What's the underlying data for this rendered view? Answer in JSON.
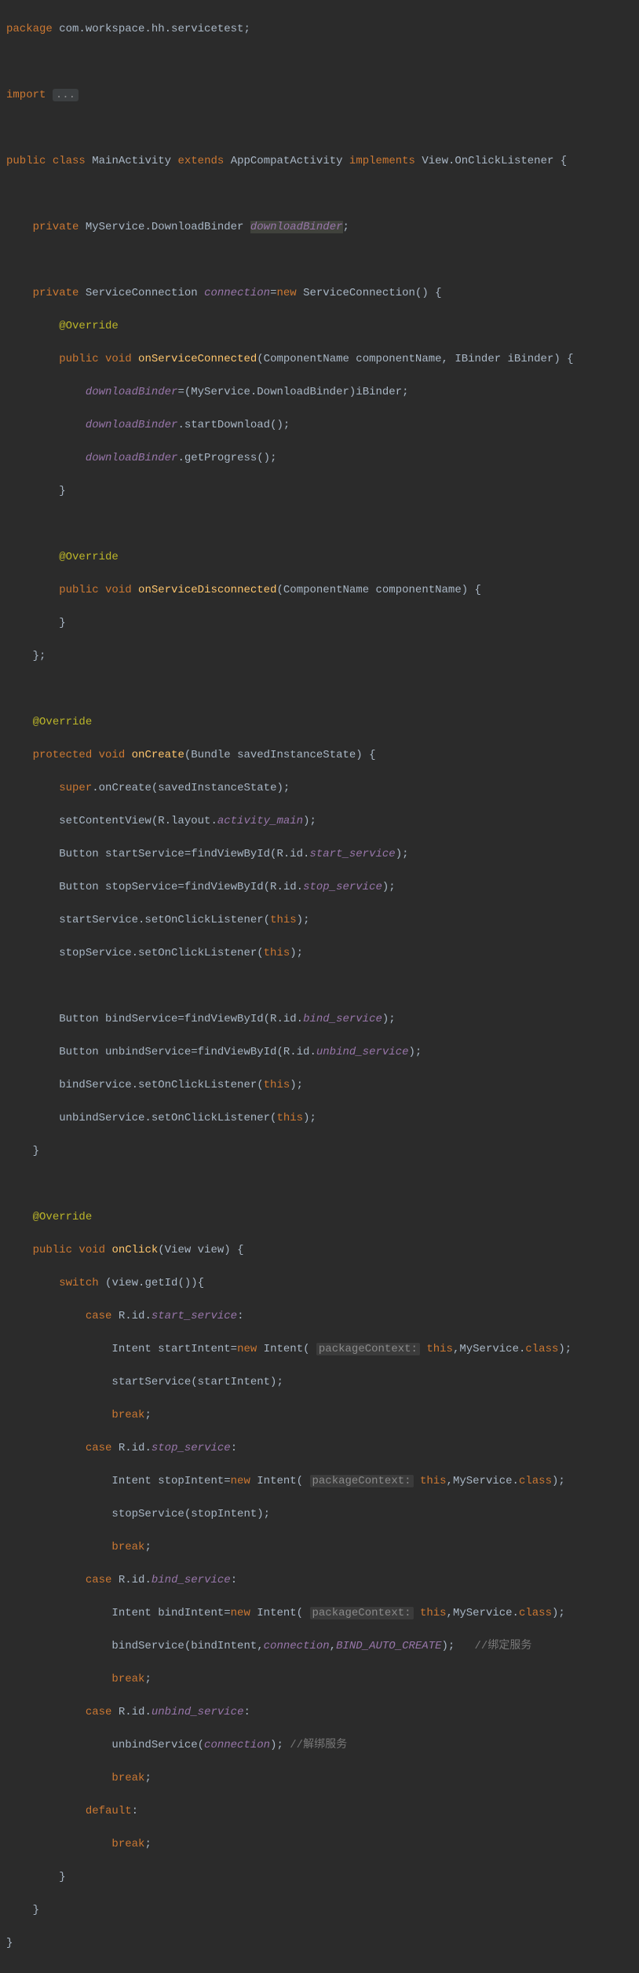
{
  "pkg_line": "package com.workspace.hh.servicetest;",
  "import_kw": "import",
  "import_fold": "...",
  "cls1": "public class ",
  "cls_name": "MainActivity",
  "cls_ext": " extends ",
  "cls_ext_name": "AppCompatActivity",
  "cls_impl": " implements ",
  "cls_impl_name": "View.OnClickListener",
  "cls_open": " {",
  "f1_mod": "    private ",
  "f1_type": "MyService.DownloadBinder ",
  "f1_name": "downloadBinder",
  "f1_end": ";",
  "f2_mod": "    private ",
  "f2_type": "ServiceConnection ",
  "f2_name": "connection",
  "f2_eq": "=",
  "f2_new": "new ",
  "f2_ctor": "ServiceConnection",
  "f2_rest": "() {",
  "override": "@Override",
  "m1_sig_a": "        public void ",
  "m1_name": "onServiceConnected",
  "m1_sig_b": "(ComponentName componentName, IBinder iBinder) {",
  "m1_l1a": "            ",
  "m1_l1b": "downloadBinder",
  "m1_l1c": "=(MyService.DownloadBinder)iBinder;",
  "m1_l2a": "            ",
  "m1_l2b": "downloadBinder",
  "m1_l2c": ".startDownload();",
  "m1_l3a": "            ",
  "m1_l3b": "downloadBinder",
  "m1_l3c": ".getProgress();",
  "m1_close": "        }",
  "m2_sig_a": "        public void ",
  "m2_name": "onServiceDisconnected",
  "m2_sig_b": "(ComponentName componentName) {",
  "m2_close": "        }",
  "f2_close": "    };",
  "over_indent": "    ",
  "oc_sig_a": "    protected void ",
  "oc_name": "onCreate",
  "oc_sig_b": "(Bundle savedInstanceState) {",
  "oc_l1_a": "        ",
  "oc_l1_b": "super",
  "oc_l1_c": ".onCreate(savedInstanceState);",
  "oc_l2_a": "        setContentView(R.layout.",
  "oc_l2_b": "activity_main",
  "oc_l2_c": ");",
  "oc_l3_a": "        Button startService=findViewById(R.id.",
  "oc_l3_b": "start_service",
  "oc_l3_c": ");",
  "oc_l4_a": "        Button stopService=findViewById(R.id.",
  "oc_l4_b": "stop_service",
  "oc_l4_c": ");",
  "oc_l5_a": "        startService.setOnClickListener(",
  "oc_l5_b": "this",
  "oc_l5_c": ");",
  "oc_l6_a": "        stopService.setOnClickListener(",
  "oc_l6_b": "this",
  "oc_l6_c": ");",
  "oc_l7_a": "        Button bindService=findViewById(R.id.",
  "oc_l7_b": "bind_service",
  "oc_l7_c": ");",
  "oc_l8_a": "        Button unbindService=findViewById(R.id.",
  "oc_l8_b": "unbind_service",
  "oc_l8_c": ");",
  "oc_l9_a": "        bindService.setOnClickListener(",
  "oc_l9_b": "this",
  "oc_l9_c": ");",
  "oc_l10_a": "        unbindService.setOnClickListener(",
  "oc_l10_b": "this",
  "oc_l10_c": ");",
  "oc_close": "    }",
  "ock_sig_a": "    public void ",
  "ock_name": "onClick",
  "ock_sig_b": "(View view) {",
  "sw_a": "        ",
  "sw_b": "switch",
  "sw_c": " (view.getId()){",
  "c1_a": "            ",
  "c1_b": "case",
  "c1_c": " R.id.",
  "c1_d": "start_service",
  "c1_e": ":",
  "c1l1_a": "                Intent startIntent=",
  "c1l1_b": "new",
  "c1l1_c": " Intent( ",
  "c1l1_hint": "packageContext:",
  "c1l1_d": " ",
  "c1l1_e": "this",
  "c1l1_f": ",MyService.",
  "c1l1_g": "class",
  "c1l1_h": ");",
  "c1l2": "                startService(startIntent);",
  "brk_a": "                ",
  "brk_b": "break",
  "brk_c": ";",
  "c2_d": "stop_service",
  "c2l1_a": "                Intent stopIntent=",
  "c2l2": "                stopService(stopIntent);",
  "c3_d": "bind_service",
  "c3l1_a": "                Intent bindIntent=",
  "c3l2_a": "                bindService(bindIntent,",
  "c3l2_b": "connection",
  "c3l2_c": ",",
  "c3l2_d": "BIND_AUTO_CREATE",
  "c3l2_e": ");   ",
  "c3l2_cmt": "//绑定服务",
  "c4_d": "unbind_service",
  "c4l1_a": "                unbindService(",
  "c4l1_b": "connection",
  "c4l1_c": "); ",
  "c4l1_cmt": "//解绑服务",
  "def_a": "            ",
  "def_b": "default",
  "def_c": ":",
  "sw_close": "        }",
  "ock_close": "    }",
  "cls_close": "}"
}
